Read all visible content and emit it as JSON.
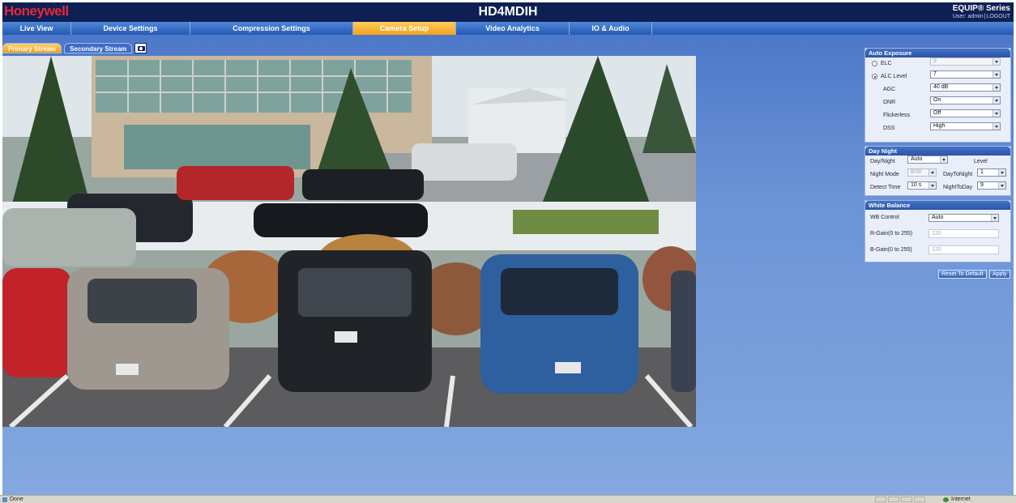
{
  "header": {
    "brand": "Honeywell",
    "model": "HD4MDIH",
    "series": "EQUIP® Series",
    "user_label": "User: admin",
    "logout": "LOGOUT"
  },
  "nav": {
    "active": "Camera Setup",
    "tabs": [
      {
        "label": "Live View"
      },
      {
        "label": "Device Settings"
      },
      {
        "label": "Compression Settings"
      },
      {
        "label": "Camera Setup"
      },
      {
        "label": "Video Analytics"
      },
      {
        "label": "IO & Audio"
      }
    ]
  },
  "streams": {
    "primary": "Primary Stream",
    "secondary": "Secondary Stream",
    "active": "Primary Stream"
  },
  "auto_exposure": {
    "title": "Auto Exposure",
    "elc_label": "ELC",
    "elc_value": "9",
    "alc_label": "ALC Level",
    "alc_value": "7",
    "agc_label": "AGC",
    "agc_value": "40 dB",
    "dnr_label": "DNR",
    "dnr_value": "On",
    "flickerless_label": "Flickerless",
    "flickerless_value": "Off",
    "dss_label": "DSS",
    "dss_value": "High",
    "selected_mode": "ALC Level"
  },
  "day_night": {
    "title": "Day Night",
    "day_night_label": "Day/Night",
    "day_night_value": "Auto",
    "level_label": "Level",
    "night_mode_label": "Night Mode",
    "night_mode_value": "B/W",
    "day_to_night_label": "DayToNight",
    "day_to_night_value": "1",
    "detect_time_label": "Detect Time",
    "detect_time_value": "10 s",
    "night_to_day_label": "NightToDay",
    "night_to_day_value": "9"
  },
  "white_balance": {
    "title": "White Balance",
    "wb_control_label": "WB Control",
    "wb_control_value": "Auto",
    "r_gain_label": "R-Gain(0 to 255)",
    "r_gain_value": "120",
    "b_gain_label": "B-Gain(0 to 255)",
    "b_gain_value": "120"
  },
  "actions": {
    "reset": "Reset To Default",
    "apply": "Apply"
  },
  "statusbar": {
    "left": "Done",
    "zone": "Internet"
  },
  "colors": {
    "header_bg": "#0e1f54",
    "brand_red": "#e8283a",
    "nav_blue": "#2459b4",
    "active_tab": "#f2a21c",
    "content_blue": "#6b93d6"
  }
}
